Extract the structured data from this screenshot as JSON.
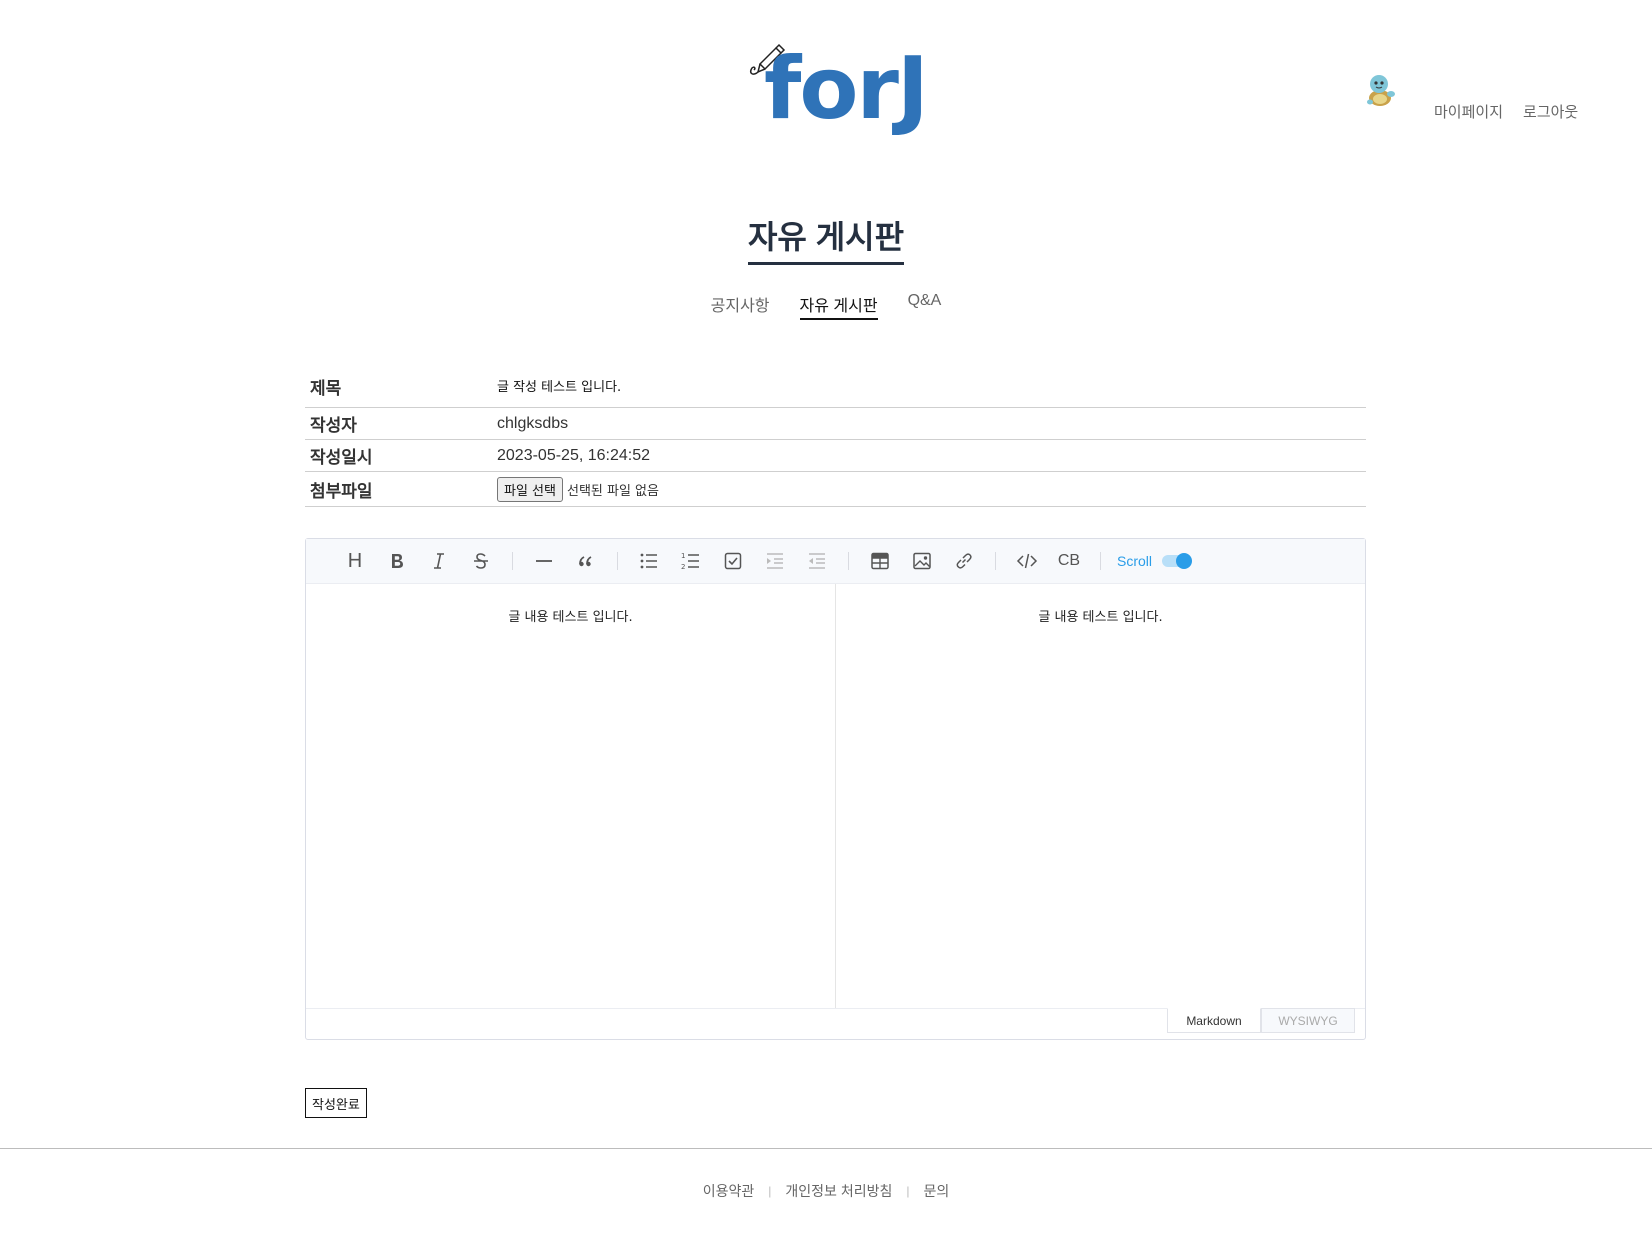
{
  "header": {
    "logo_text": "forJ",
    "mypage_label": "마이페이지",
    "logout_label": "로그아웃"
  },
  "board": {
    "title": "자유 게시판",
    "tabs": [
      {
        "label": "공지사항",
        "active": false
      },
      {
        "label": "자유 게시판",
        "active": true
      },
      {
        "label": "Q&A",
        "active": false
      }
    ]
  },
  "form": {
    "title_label": "제목",
    "title_value": "글 작성 테스트 입니다.",
    "author_label": "작성자",
    "author_value": "chlgksdbs",
    "date_label": "작성일시",
    "date_value": "2023-05-25, 16:24:52",
    "file_label": "첨부파일",
    "file_button": "파일 선택",
    "file_status": "선택된 파일 없음"
  },
  "editor": {
    "toolbar": {
      "heading_label": "H",
      "codeblock_label": "CB",
      "scroll_label": "Scroll",
      "scroll_on": true
    },
    "markdown_content": "글 내용 테스트 입니다.",
    "preview_content": "글 내용 테스트 입니다.",
    "mode_tabs": [
      "Markdown",
      "WYSIWYG"
    ],
    "active_mode": "Markdown"
  },
  "submit_label": "작성완료",
  "footer": {
    "links": [
      "이용약관",
      "개인정보 처리방침",
      "문의"
    ],
    "separator": "|"
  },
  "colors": {
    "brand": "#2f73b8",
    "title": "#253040",
    "accent": "#2a9de8"
  }
}
